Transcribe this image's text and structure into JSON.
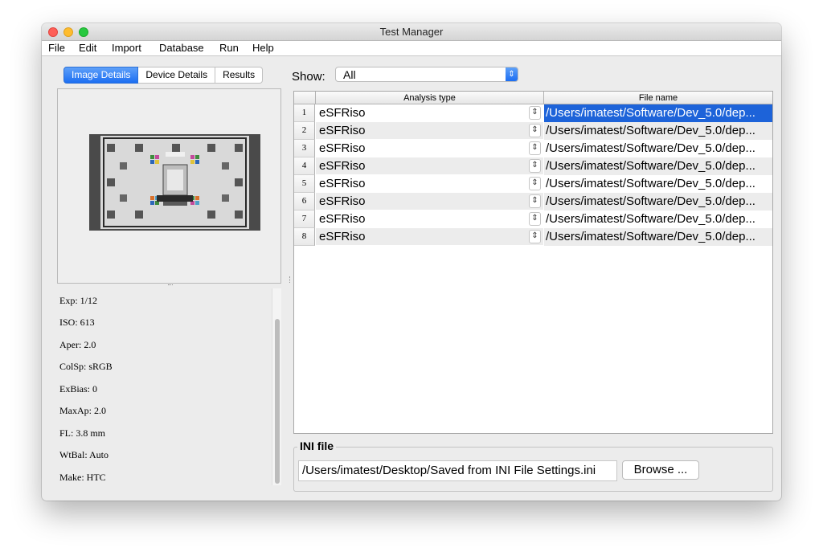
{
  "window": {
    "title": "Test Manager"
  },
  "menu": [
    "File",
    "Edit",
    "Import",
    "Database",
    "Run",
    "Help"
  ],
  "tabs": [
    "Image Details",
    "Device Details",
    "Results"
  ],
  "details": [
    "Exp: 1/12",
    "ISO: 613",
    "Aper: 2.0",
    "ColSp: sRGB",
    "ExBias: 0",
    "MaxAp: 2.0",
    "FL: 3.8 mm",
    "WtBal: Auto",
    "Make: HTC"
  ],
  "show": {
    "label": "Show:",
    "value": "All"
  },
  "table": {
    "columns": [
      "Analysis type",
      "File name"
    ],
    "rows": [
      {
        "num": "1",
        "type": "eSFRiso",
        "file": "/Users/imatest/Software/Dev_5.0/dep..."
      },
      {
        "num": "2",
        "type": "eSFRiso",
        "file": "/Users/imatest/Software/Dev_5.0/dep..."
      },
      {
        "num": "3",
        "type": "eSFRiso",
        "file": "/Users/imatest/Software/Dev_5.0/dep..."
      },
      {
        "num": "4",
        "type": "eSFRiso",
        "file": "/Users/imatest/Software/Dev_5.0/dep..."
      },
      {
        "num": "5",
        "type": "eSFRiso",
        "file": "/Users/imatest/Software/Dev_5.0/dep..."
      },
      {
        "num": "6",
        "type": "eSFRiso",
        "file": "/Users/imatest/Software/Dev_5.0/dep..."
      },
      {
        "num": "7",
        "type": "eSFRiso",
        "file": "/Users/imatest/Software/Dev_5.0/dep..."
      },
      {
        "num": "8",
        "type": "eSFRiso",
        "file": "/Users/imatest/Software/Dev_5.0/dep..."
      }
    ]
  },
  "ini": {
    "title": "INI file",
    "path": "/Users/imatest/Desktop/Saved from INI File Settings.ini",
    "browse_label": "Browse ..."
  },
  "colors": {
    "accent": "#1c6ef2",
    "selection": "#1d63d9"
  },
  "icons": {
    "select_arrow": "chevron-up-down-icon",
    "row_stepper": "chevron-up-down-icon"
  }
}
